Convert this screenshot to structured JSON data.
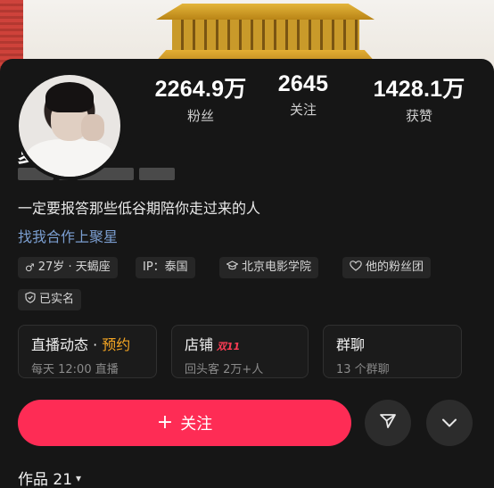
{
  "profile": {
    "name": "夏宁",
    "bio": "一定要报答那些低谷期陪你走过来的人",
    "link": "找我合作上聚星"
  },
  "stats": [
    {
      "value": "2264.9万",
      "label": "粉丝"
    },
    {
      "value": "2645",
      "label": "关注"
    },
    {
      "value": "1428.1万",
      "label": "获赞"
    }
  ],
  "tags": [
    {
      "icon": "male-icon",
      "glyph": "♂",
      "text": "27岁 · 天蝎座"
    },
    {
      "icon": "none",
      "glyph": "",
      "text": "IP：泰国"
    },
    {
      "icon": "graduation-cap-icon",
      "glyph": "🎓",
      "text": "北京电影学院"
    },
    {
      "icon": "heart-icon",
      "glyph": "♡",
      "text": "他的粉丝团"
    },
    {
      "icon": "shield-check-icon",
      "glyph": "✓",
      "text": "已实名"
    }
  ],
  "panels": {
    "live": {
      "title": "直播动态",
      "sep": " · ",
      "highlight": "预约",
      "sub": "每天 12:00 直播"
    },
    "shop": {
      "title": "店铺",
      "badge": "双11",
      "sub": "回头客 2万+人"
    },
    "group": {
      "title": "群聊",
      "sub": "13 个群聊"
    }
  },
  "actions": {
    "follow_plus": "+",
    "follow_label": "关注",
    "share_icon": "send-icon",
    "more_icon": "chevron-down-icon"
  },
  "works": {
    "label": "作品 21",
    "caret": "▾"
  },
  "colors": {
    "accent": "#fe2c55",
    "link": "#7b9ed0",
    "bg": "#161616",
    "highlight": "#f5a623"
  }
}
